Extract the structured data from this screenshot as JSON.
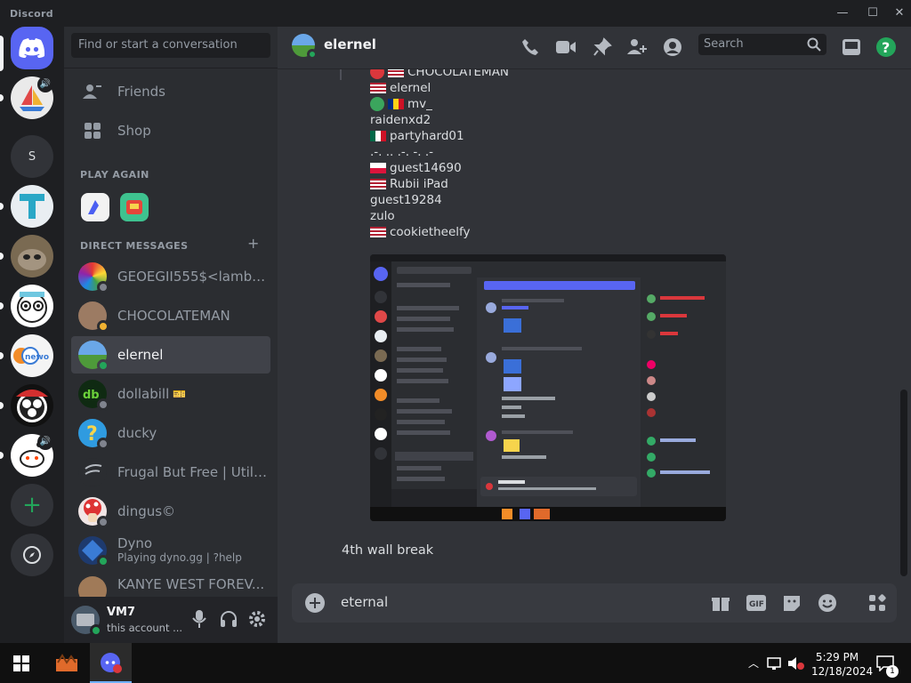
{
  "window": {
    "title": "Discord"
  },
  "colors": {
    "blurple": "#5865f2",
    "online": "#23a55a",
    "idle": "#f0b232",
    "bg": "#313338",
    "sidebar": "#2b2d31"
  },
  "sidebar": {
    "search_placeholder": "Find or start a conversation",
    "friends_label": "Friends",
    "shop_label": "Shop",
    "play_again_heading": "PLAY AGAIN",
    "dm_heading": "DIRECT MESSAGES",
    "dms": [
      {
        "name": "GEOEGII555$<lambd...",
        "status": "offline"
      },
      {
        "name": "CHOCOLATEMAN",
        "status": "idle"
      },
      {
        "name": "elernel",
        "status": "online"
      },
      {
        "name": "dollabill",
        "status": "offline",
        "badge": "🎫"
      },
      {
        "name": "ducky",
        "status": "offline"
      },
      {
        "name": "Frugal But Free | Utilit...",
        "status": "offline"
      },
      {
        "name": "dingus©",
        "status": "offline"
      },
      {
        "name": "Dyno",
        "sub": "Playing dyno.gg | ?help",
        "status": "online"
      },
      {
        "name": "KANYE WEST FOREV...",
        "status": "offline"
      }
    ]
  },
  "server_rail": {
    "letter_server": "S"
  },
  "user": {
    "name": "VM7",
    "status_text": "this account ..."
  },
  "header": {
    "channel_name": "elernel",
    "search_placeholder": "Search"
  },
  "messages": {
    "lines": [
      {
        "text": "CHOCOLATEMAN",
        "dot": "#da373c",
        "flag": "us"
      },
      {
        "text": "elernel",
        "flag": "us"
      },
      {
        "text": "mv_",
        "dot": "#3ba55d",
        "flag": "ro"
      },
      {
        "text": "raidenxd2"
      },
      {
        "text": "partyhard01",
        "flag": "mx"
      },
      {
        "text": ".-. .. .-. -. .-"
      },
      {
        "text": "guest14690",
        "flag": "pl"
      },
      {
        "text": "Rubii iPad",
        "flag": "us"
      },
      {
        "text": "guest19284"
      },
      {
        "text": "zulo"
      },
      {
        "text": "cookietheelfy",
        "flag": "us"
      }
    ],
    "caption": "4th wall break"
  },
  "composer": {
    "value": "eternal"
  },
  "taskbar": {
    "time": "5:29 PM",
    "date": "12/18/2024",
    "notif_count": "1"
  }
}
